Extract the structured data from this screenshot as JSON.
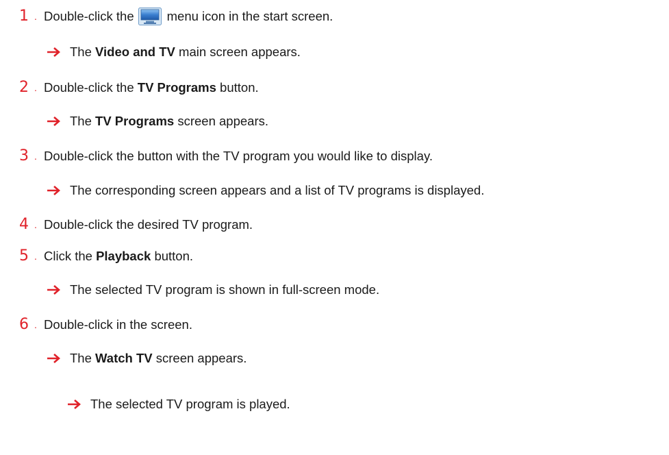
{
  "colors": {
    "step_number": "#e0222a",
    "arrow": "#e0222a",
    "text": "#1a1a1a",
    "icon_blue": "#3b7fd0"
  },
  "steps": [
    {
      "number": "1",
      "dot": ".",
      "pre": "Double-click the",
      "post": "menu icon in the start screen."
    },
    {
      "number": "2",
      "dot": ".",
      "pre": "Double-click the ",
      "bold": "TV Programs",
      "post": " button."
    },
    {
      "number": "3",
      "dot": ".",
      "pre": "Double-click the button with the TV program you would like to display."
    },
    {
      "number": "4",
      "dot": ".",
      "pre": "Double-click the desired TV program."
    },
    {
      "number": "5",
      "dot": ".",
      "pre": "Click the ",
      "bold": "Playback",
      "post": " button."
    },
    {
      "number": "6",
      "dot": ".",
      "pre": "Double-click in the screen."
    }
  ],
  "results": [
    {
      "pre": "The ",
      "bold": "Video and TV",
      "post": " main screen appears."
    },
    {
      "pre": "The ",
      "bold": "TV Programs",
      "post": " screen appears."
    },
    {
      "pre": "The corresponding screen appears and a list of TV programs is displayed."
    },
    {
      "pre": "The selected TV program is shown in full-screen mode."
    },
    {
      "pre": "The ",
      "bold": "Watch TV",
      "post": " screen appears."
    },
    {
      "pre": "The selected TV program is played."
    }
  ],
  "icons": {
    "menu_icon": "tv-monitor-icon",
    "result_arrow": "right-arrow-icon"
  }
}
